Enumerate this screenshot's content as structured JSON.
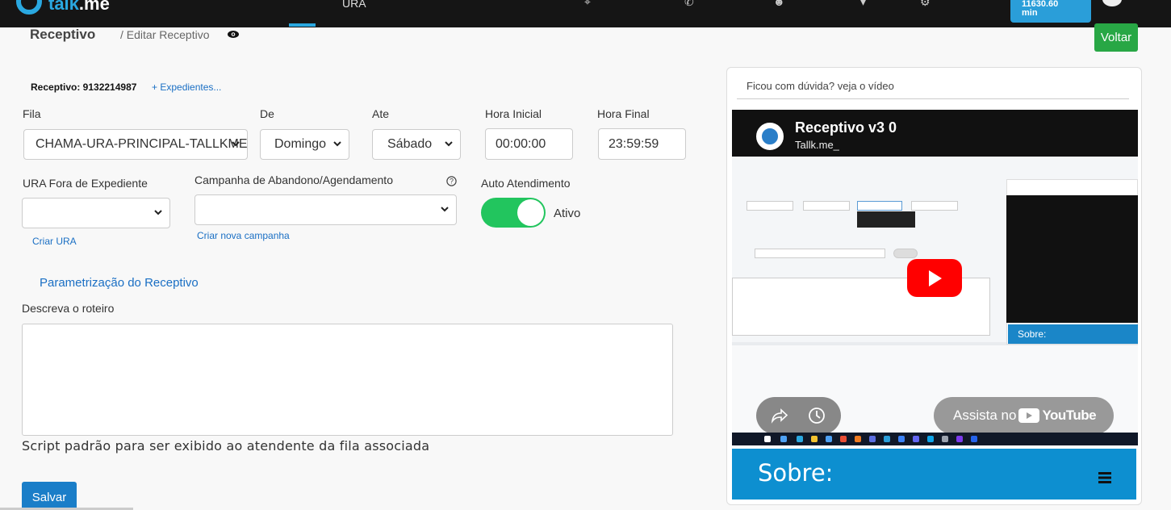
{
  "nav": {
    "logo_prefix": "talk",
    "logo_suffix": ".me",
    "active_tab": "URA",
    "balance": "11630.60",
    "balance_unit": "min"
  },
  "header": {
    "title": "Receptivo",
    "breadcrumb": "/ Editar Receptivo",
    "back_button": "Voltar"
  },
  "form": {
    "receptivo_id": "Receptivo: 9132214987",
    "expedientes_link": "+ Expedientes...",
    "fila_label": "Fila",
    "fila_value": "CHAMA-URA-PRINCIPAL-TALLKME",
    "de_label": "De",
    "de_value": "Domingo",
    "ate_label": "Ate",
    "ate_value": "Sábado",
    "hora_inicial_label": "Hora Inicial",
    "hora_inicial_value": "00:00:00",
    "hora_final_label": "Hora Final",
    "hora_final_value": "23:59:59",
    "ura_label": "URA Fora de Expediente",
    "ura_value": "",
    "criar_ura": "Criar URA",
    "campanha_label": "Campanha de Abandono/Agendamento",
    "campanha_value": "",
    "criar_campanha": "Criar nova campanha",
    "auto_label": "Auto Atendimento",
    "auto_status": "Ativo",
    "auto_on": true,
    "param_link": "Parametrização do Receptivo",
    "roteiro_label": "Descreva o roteiro",
    "roteiro_value": "",
    "roteiro_hint": "Script padrão para ser exibido ao atendente da fila associada",
    "save_button": "Salvar"
  },
  "video_card": {
    "title": "Ficou com dúvida? veja o vídeo",
    "video_title": "Receptivo v3 0",
    "video_channel": "Tallk.me_",
    "inner_side_label": "Sobre:",
    "watch_on": "Assista no",
    "youtube": "YouTube",
    "sobre_label": "Sobre:"
  },
  "colors": {
    "primary": "#1a7ec8",
    "success": "#28a745",
    "toggle": "#22c55e",
    "link": "#1a6fc4",
    "sobre": "#0d8fd0"
  }
}
